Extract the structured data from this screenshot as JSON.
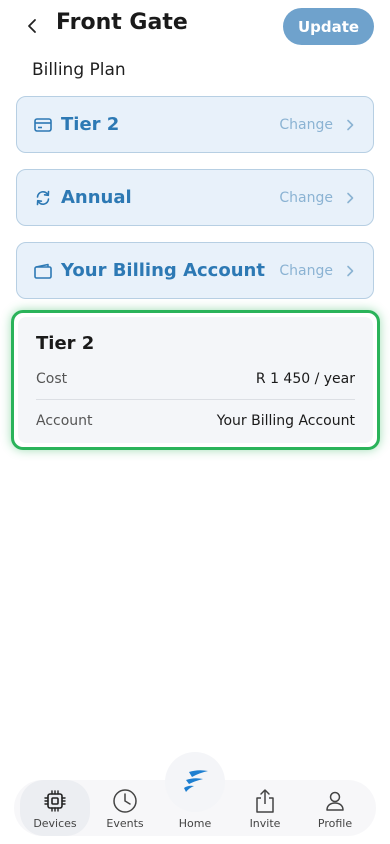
{
  "header": {
    "title": "Front Gate",
    "update_label": "Update"
  },
  "section_label": "Billing Plan",
  "options": [
    {
      "icon": "credit-card-icon",
      "label": "Tier 2",
      "change": "Change"
    },
    {
      "icon": "refresh-icon",
      "label": "Annual",
      "change": "Change"
    },
    {
      "icon": "wallet-icon",
      "label": "Your Billing Account",
      "change": "Change"
    }
  ],
  "summary": {
    "title": "Tier 2",
    "rows": [
      {
        "key": "Cost",
        "value": "R 1 450 / year"
      },
      {
        "key": "Account",
        "value": "Your Billing Account"
      }
    ]
  },
  "tabbar": {
    "items": [
      {
        "label": "Devices",
        "icon": "chip-icon",
        "active": true
      },
      {
        "label": "Events",
        "icon": "clock-icon"
      },
      {
        "label": "Home",
        "icon": "logo-icon"
      },
      {
        "label": "Invite",
        "icon": "share-icon"
      },
      {
        "label": "Profile",
        "icon": "person-icon"
      }
    ]
  },
  "colors": {
    "accent": "#2d79b4",
    "option_bg": "#e8f1fa",
    "highlight_border": "#2ab35a",
    "update_button": "#6fa2cc"
  }
}
